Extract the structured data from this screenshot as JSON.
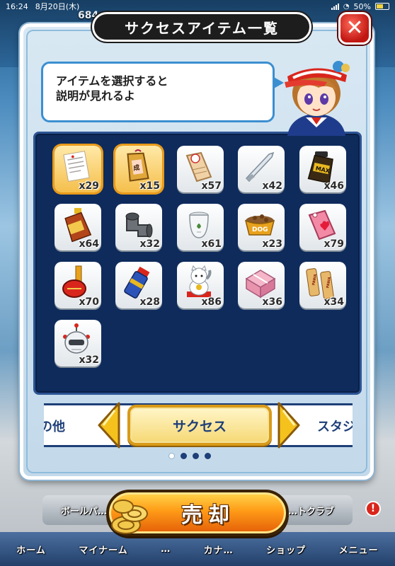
{
  "status_bar": {
    "time": "16:24",
    "date": "8月20日(木)",
    "battery": "50%"
  },
  "background": {
    "counter": "684…"
  },
  "modal": {
    "title": "サクセスアイテム一覧",
    "close_label": "✕",
    "hint_line1": "アイテムを選択すると",
    "hint_line2": "説明が見れるよ"
  },
  "items": [
    {
      "name": "document",
      "count": "x29",
      "selected": true
    },
    {
      "name": "success-charm",
      "count": "x15",
      "selected": true
    },
    {
      "name": "baseball-tag",
      "count": "x57",
      "selected": false
    },
    {
      "name": "knife",
      "count": "x42",
      "selected": false
    },
    {
      "name": "max-drink",
      "count": "x46",
      "selected": false
    },
    {
      "name": "tonic-bottle",
      "count": "x64",
      "selected": false
    },
    {
      "name": "pipe-joint",
      "count": "x32",
      "selected": false
    },
    {
      "name": "aroma-pot",
      "count": "x61",
      "selected": false
    },
    {
      "name": "dog-food",
      "count": "x23",
      "selected": false
    },
    {
      "name": "heart-tag",
      "count": "x79",
      "selected": false
    },
    {
      "name": "red-toy",
      "count": "x70",
      "selected": false
    },
    {
      "name": "spray-can",
      "count": "x28",
      "selected": false
    },
    {
      "name": "lucky-cat",
      "count": "x86",
      "selected": false
    },
    {
      "name": "gift-box",
      "count": "x36",
      "selected": false
    },
    {
      "name": "pawa-bars",
      "count": "x34",
      "selected": false
    },
    {
      "name": "robot-head",
      "count": "x32",
      "selected": false
    }
  ],
  "category": {
    "prev_label": "の他",
    "current_label": "サクセス",
    "next_label": "スタジ",
    "page_count": 4,
    "active_page": 1
  },
  "sell_button": {
    "label": "売却"
  },
  "bottom_nav": {
    "sub_left": "ボールパ…",
    "sub_right": "…トクラブ",
    "items": [
      "ホーム",
      "マイナーム",
      "…",
      "カナ…",
      "ショップ",
      "メニュー"
    ]
  },
  "colors": {
    "panel_navy": "#0e2b5c",
    "accent_gold": "#d99a17",
    "close_red": "#c11712",
    "bubble_blue": "#3b8fd1"
  }
}
